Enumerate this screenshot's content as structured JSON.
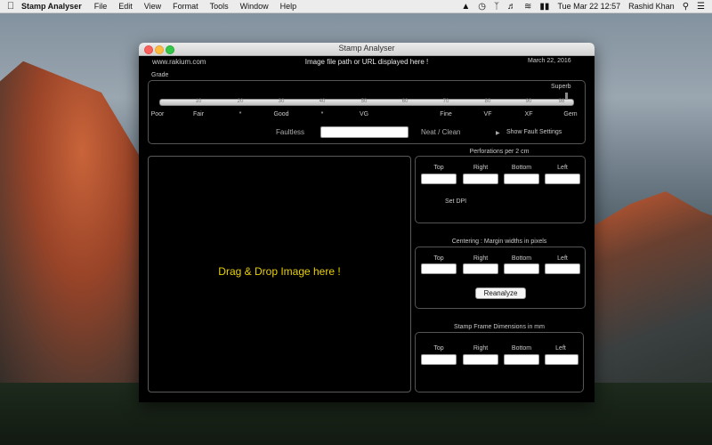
{
  "menubar": {
    "app_name": "Stamp Analyser",
    "menus": [
      "File",
      "Edit",
      "View",
      "Format",
      "Tools",
      "Window",
      "Help"
    ],
    "clock": "Tue Mar 22  12:57",
    "user": "Rashid Khan"
  },
  "window": {
    "title": "Stamp Analyser",
    "website": "www.rakium.com",
    "header_message": "Image file path or URL displayed here !",
    "date": "March 22, 2016"
  },
  "grade": {
    "label": "Grade",
    "top_label": "Superb",
    "tick_numbers": [
      "10",
      "20",
      "30",
      "40",
      "50",
      "60",
      "70",
      "80",
      "90",
      "98"
    ],
    "labels": [
      "Poor",
      "Fair",
      "*",
      "Good",
      "*",
      "VG",
      "Fine",
      "VF",
      "XF",
      "Gem"
    ],
    "value": 98,
    "max": 100
  },
  "faults": {
    "faultless_label": "Faultless",
    "faultless_value": "",
    "neat_label": "Neat / Clean",
    "show_fault_label": "Show Fault Settings"
  },
  "dropzone": {
    "message": "Drag & Drop Image here !"
  },
  "perforations": {
    "title": "Perforations per 2 cm",
    "cols": [
      "Top",
      "Right",
      "Bottom",
      "Left"
    ],
    "values": [
      "",
      "",
      "",
      ""
    ],
    "set_dpi": "Set DPI"
  },
  "centering": {
    "title": "Centering : Margin widths in pixels",
    "cols": [
      "Top",
      "Right",
      "Bottom",
      "Left"
    ],
    "values": [
      "",
      "",
      "",
      ""
    ],
    "reanalyze": "Reanalyze"
  },
  "frame": {
    "title": "Stamp Frame Dimensions in mm",
    "cols": [
      "Top",
      "Right",
      "Bottom",
      "Left"
    ],
    "values": [
      "",
      "",
      "",
      ""
    ]
  },
  "icons": [
    "apple-icon",
    "upload-icon",
    "time-machine-icon",
    "bluetooth-icon",
    "volume-icon",
    "wifi-icon",
    "battery-icon",
    "search-icon",
    "list-icon",
    "triangle-right-icon"
  ]
}
